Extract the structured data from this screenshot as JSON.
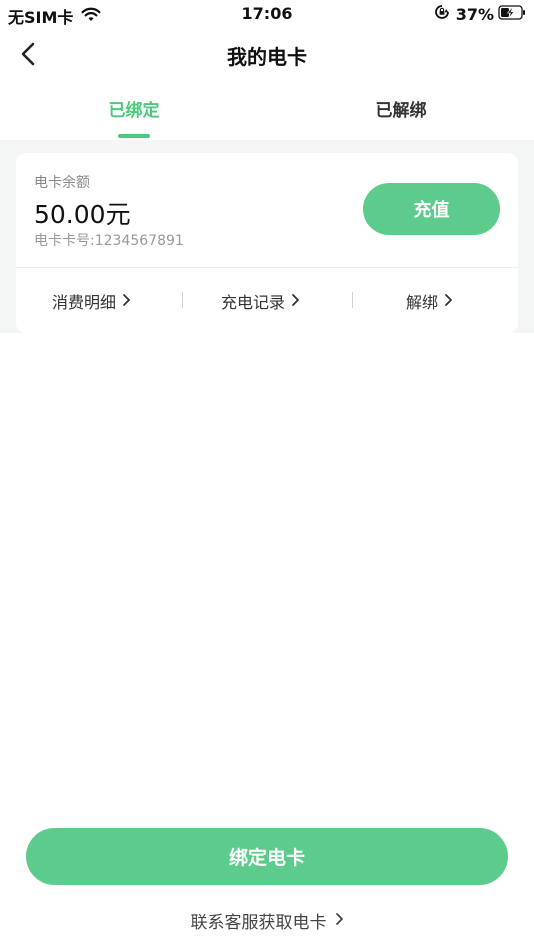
{
  "status_bar": {
    "carrier": "无SIM卡",
    "time": "17:06",
    "battery": "37%"
  },
  "nav": {
    "title": "我的电卡"
  },
  "tabs": [
    {
      "label": "已绑定",
      "active": true
    },
    {
      "label": "已解绑",
      "active": false
    }
  ],
  "card": {
    "balance_label": "电卡余额",
    "balance_value": "50.00元",
    "card_number_label": "电卡卡号:",
    "card_number": "1234567891",
    "recharge_label": "充值",
    "actions": [
      "消费明细",
      "充电记录",
      "解绑"
    ]
  },
  "bottom": {
    "bind_label": "绑定电卡",
    "service_label": "联系客服获取电卡"
  },
  "colors": {
    "accent": "#5dcb8b",
    "tab_active": "#4cc97d",
    "background_band": "#f4f6f5"
  },
  "icons": [
    "wifi-icon",
    "lock-rotation-icon",
    "battery-charging-icon",
    "back-arrow-icon",
    "chevron-right-icon"
  ]
}
